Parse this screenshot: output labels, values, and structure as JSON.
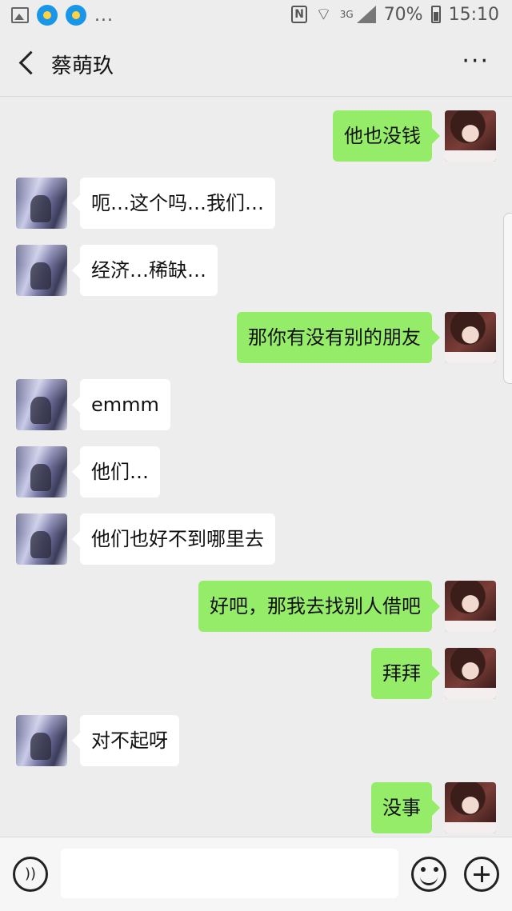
{
  "status_bar": {
    "more": "...",
    "network": "3G",
    "battery": "70%",
    "time": "15:10"
  },
  "header": {
    "back_icon": "chevron-left-icon",
    "title": "蔡萌玖",
    "more": "···"
  },
  "messages": [
    {
      "side": "out",
      "text": "他也没钱"
    },
    {
      "side": "in",
      "text": "呃…这个吗…我们…"
    },
    {
      "side": "in",
      "text": "经济…稀缺…"
    },
    {
      "side": "out",
      "text": "那你有没有别的朋友"
    },
    {
      "side": "in",
      "text": "emmm"
    },
    {
      "side": "in",
      "text": "他们…"
    },
    {
      "side": "in",
      "text": "他们也好不到哪里去"
    },
    {
      "side": "out",
      "text": "好吧，那我去找别人借吧"
    },
    {
      "side": "out",
      "text": "拜拜"
    },
    {
      "side": "in",
      "text": "对不起呀"
    },
    {
      "side": "out",
      "text": "没事"
    }
  ],
  "input_bar": {
    "voice_icon": "voice-icon",
    "input_value": "",
    "emoji_icon": "emoji-icon",
    "plus_icon": "plus-icon"
  }
}
